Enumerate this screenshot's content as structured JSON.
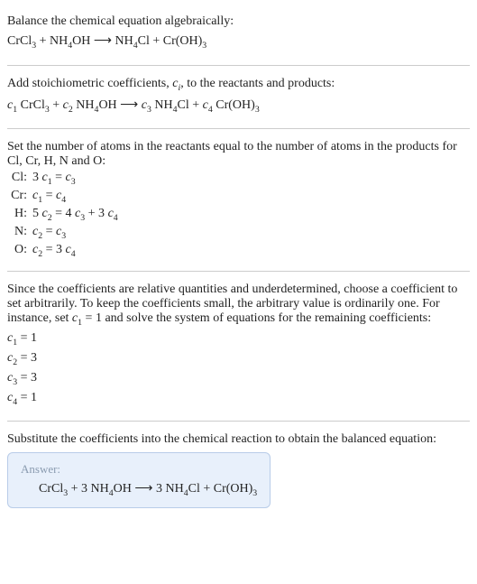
{
  "intro_line": "Balance the chemical equation algebraically:",
  "equation_unbalanced": "CrCl₃ + NH₄OH ⟶ NH₄Cl + Cr(OH)₃",
  "stoich_text": "Add stoichiometric coefficients, cᵢ, to the reactants and products:",
  "equation_with_coeffs": "c₁ CrCl₃ + c₂ NH₄OH ⟶ c₃ NH₄Cl + c₄ Cr(OH)₃",
  "set_atoms_text": "Set the number of atoms in the reactants equal to the number of atoms in the products for Cl, Cr, H, N and O:",
  "atom_equations": [
    {
      "element": "Cl:",
      "eq": "3 c₁ = c₃"
    },
    {
      "element": "Cr:",
      "eq": "c₁ = c₄"
    },
    {
      "element": "H:",
      "eq": "5 c₂ = 4 c₃ + 3 c₄"
    },
    {
      "element": "N:",
      "eq": "c₂ = c₃"
    },
    {
      "element": "O:",
      "eq": "c₂ = 3 c₄"
    }
  ],
  "underdetermined_text": "Since the coefficients are relative quantities and underdetermined, choose a coefficient to set arbitrarily. To keep the coefficients small, the arbitrary value is ordinarily one. For instance, set c₁ = 1 and solve the system of equations for the remaining coefficients:",
  "solutions": [
    "c₁ = 1",
    "c₂ = 3",
    "c₃ = 3",
    "c₄ = 1"
  ],
  "substitute_text": "Substitute the coefficients into the chemical reaction to obtain the balanced equation:",
  "answer_label": "Answer:",
  "answer_equation": "CrCl₃ + 3 NH₄OH ⟶ 3 NH₄Cl + Cr(OH)₃",
  "chart_data": {
    "type": "table",
    "reaction": {
      "reactants": [
        {
          "species": "CrCl3",
          "coefficient": 1
        },
        {
          "species": "NH4OH",
          "coefficient": 3
        }
      ],
      "products": [
        {
          "species": "NH4Cl",
          "coefficient": 3
        },
        {
          "species": "Cr(OH)3",
          "coefficient": 1
        }
      ]
    },
    "element_balance": [
      {
        "element": "Cl",
        "equation": "3 c1 = c3"
      },
      {
        "element": "Cr",
        "equation": "c1 = c4"
      },
      {
        "element": "H",
        "equation": "5 c2 = 4 c3 + 3 c4"
      },
      {
        "element": "N",
        "equation": "c2 = c3"
      },
      {
        "element": "O",
        "equation": "c2 = 3 c4"
      }
    ],
    "coefficient_solution": {
      "c1": 1,
      "c2": 3,
      "c3": 3,
      "c4": 1
    }
  }
}
